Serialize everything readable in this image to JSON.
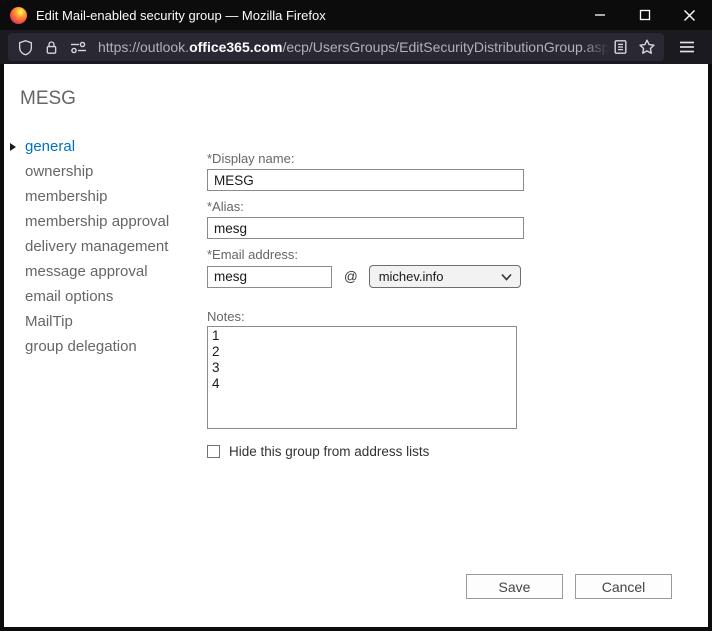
{
  "window": {
    "title": "Edit Mail-enabled security group — Mozilla Firefox"
  },
  "toolbar": {
    "url": {
      "prefix": "https://outlook.",
      "domain": "office365.com",
      "path": "/ecp/UsersGroups/EditSecurityDistributionGroup.aspx?Activ"
    }
  },
  "page": {
    "title": "MESG",
    "nav": [
      {
        "label": "general",
        "selected": true
      },
      {
        "label": "ownership"
      },
      {
        "label": "membership"
      },
      {
        "label": "membership approval"
      },
      {
        "label": "delivery management"
      },
      {
        "label": "message approval"
      },
      {
        "label": "email options"
      },
      {
        "label": "MailTip"
      },
      {
        "label": "group delegation"
      }
    ],
    "form": {
      "display_name": {
        "label": "*Display name:",
        "value": "MESG"
      },
      "alias": {
        "label": "*Alias:",
        "value": "mesg"
      },
      "email_address": {
        "label": "*Email address:",
        "value": "mesg",
        "separator": "@",
        "domain": "michev.info"
      },
      "notes": {
        "label": "Notes:",
        "value": "1\n2\n3\n4"
      },
      "hide_from_address_lists": {
        "label": "Hide this group from address lists",
        "checked": false
      }
    },
    "actions": {
      "save": "Save",
      "cancel": "Cancel"
    }
  },
  "colors": {
    "accent_blue": "#0072c6",
    "titlebar_bg": "#0c0c0d",
    "toolbar_bg": "#1b1a21",
    "urlbar_bg": "#2a2933"
  }
}
